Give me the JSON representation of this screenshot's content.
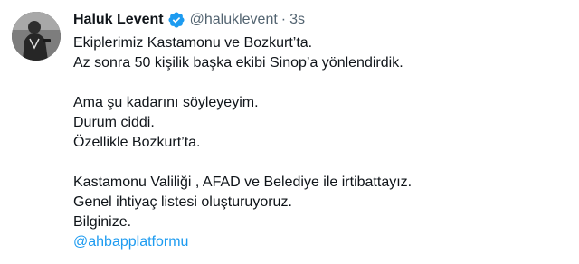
{
  "author": {
    "display_name": "Haluk Levent",
    "handle": "@haluklevent",
    "separator": "·",
    "time": "3s",
    "verified": true,
    "avatar_icon": "profile-photo-icon"
  },
  "tweet": {
    "paragraph_1": [
      "Ekiplerimiz Kastamonu ve Bozkurt’ta.",
      "Az sonra 50 kişilik başka ekibi Sinop’a yönlendirdik."
    ],
    "paragraph_2": [
      "Ama şu kadarını söyleyeyim.",
      "Durum ciddi.",
      "Özellikle Bozkurt’ta."
    ],
    "paragraph_3": [
      "Kastamonu Valiliği , AFAD ve Belediye ile irtibattayız.",
      "Genel ihtiyaç listesi oluşturuyoruz.",
      "Bilginize."
    ],
    "mention": "@ahbapplatformu"
  },
  "colors": {
    "text": "#0f1419",
    "secondary": "#536471",
    "link": "#1d9bf0",
    "verified": "#1d9bf0"
  }
}
